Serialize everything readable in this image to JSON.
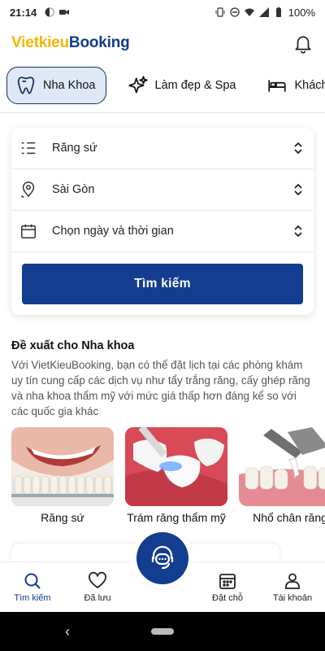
{
  "status_bar": {
    "time": "21:14",
    "battery": "100%"
  },
  "header": {
    "logo_part1": "Vietkieu",
    "logo_part2": "Booking"
  },
  "tabs": [
    {
      "label": "Nha Khoa",
      "icon": "tooth-icon",
      "active": true
    },
    {
      "label": "Làm đẹp & Spa",
      "icon": "sparkle-icon",
      "active": false
    },
    {
      "label": "Khách s",
      "icon": "bed-icon",
      "active": false
    }
  ],
  "search": {
    "service": "Răng sứ",
    "location": "Sài Gòn",
    "datetime": "Chọn ngày và thời gian",
    "button": "Tìm kiếm"
  },
  "suggest": {
    "title": "Đề xuất cho Nha khoa",
    "description": "Với VietKieuBooking, bạn có thể đặt lịch tại các phòng khám uy tín cung cấp các dịch vụ như tẩy trắng răng, cấy ghép răng và nha khoa thẩm mỹ với mức giá thấp hơn đáng kể so với các quốc gia khác"
  },
  "services": [
    {
      "label": "Răng sứ"
    },
    {
      "label": "Trám răng thẩm mỹ"
    },
    {
      "label": "Nhổ chân răng"
    }
  ],
  "bottom_nav": {
    "search": "Tìm kiếm",
    "saved": "Đã lưu",
    "booking": "Đặt chỗ",
    "account": "Tài khoản"
  },
  "colors": {
    "brand_blue": "#133d8e",
    "brand_yellow": "#f5b400",
    "active_tab_bg": "#dfe8f7"
  }
}
